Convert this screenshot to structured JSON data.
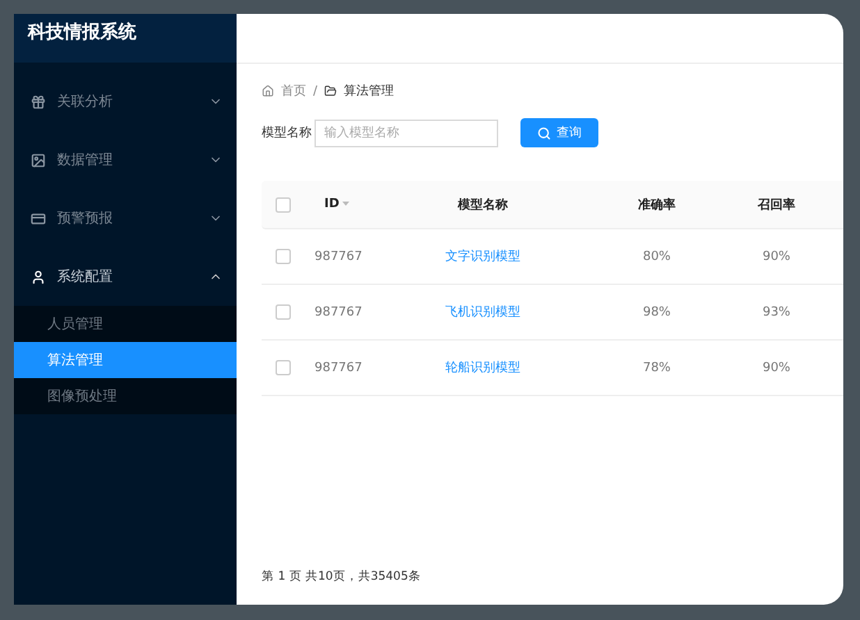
{
  "sidebar": {
    "title": "科技情报系统",
    "items": [
      {
        "kind": "group",
        "label": "关联分析",
        "expanded": false
      },
      {
        "kind": "group",
        "label": "数据管理",
        "expanded": false
      },
      {
        "kind": "group",
        "label": "预警预报",
        "expanded": false
      },
      {
        "kind": "group",
        "label": "系统配置",
        "expanded": true,
        "children": [
          {
            "label": "人员管理",
            "selected": false
          },
          {
            "label": "算法管理",
            "selected": true
          },
          {
            "label": "图像预处理",
            "selected": false
          }
        ]
      }
    ]
  },
  "breadcrumb": {
    "items": [
      "首页",
      "算法管理"
    ],
    "separator": "/"
  },
  "search": {
    "label": "模型名称",
    "placeholder": "输入模型名称",
    "button": "查询"
  },
  "table": {
    "header_checked": false,
    "columns": [
      "ID",
      "模型名称",
      "准确率",
      "召回率"
    ],
    "rows": [
      {
        "checked": false,
        "cells": [
          "987767",
          "文字识别模型",
          "80%",
          "90%"
        ]
      },
      {
        "checked": false,
        "cells": [
          "987767",
          "飞机识别模型",
          "98%",
          "93%"
        ]
      },
      {
        "checked": false,
        "cells": [
          "987767",
          "轮船识别模型",
          "78%",
          "90%"
        ]
      }
    ]
  },
  "pagination": "第 1 页 共10页，共35405条"
}
